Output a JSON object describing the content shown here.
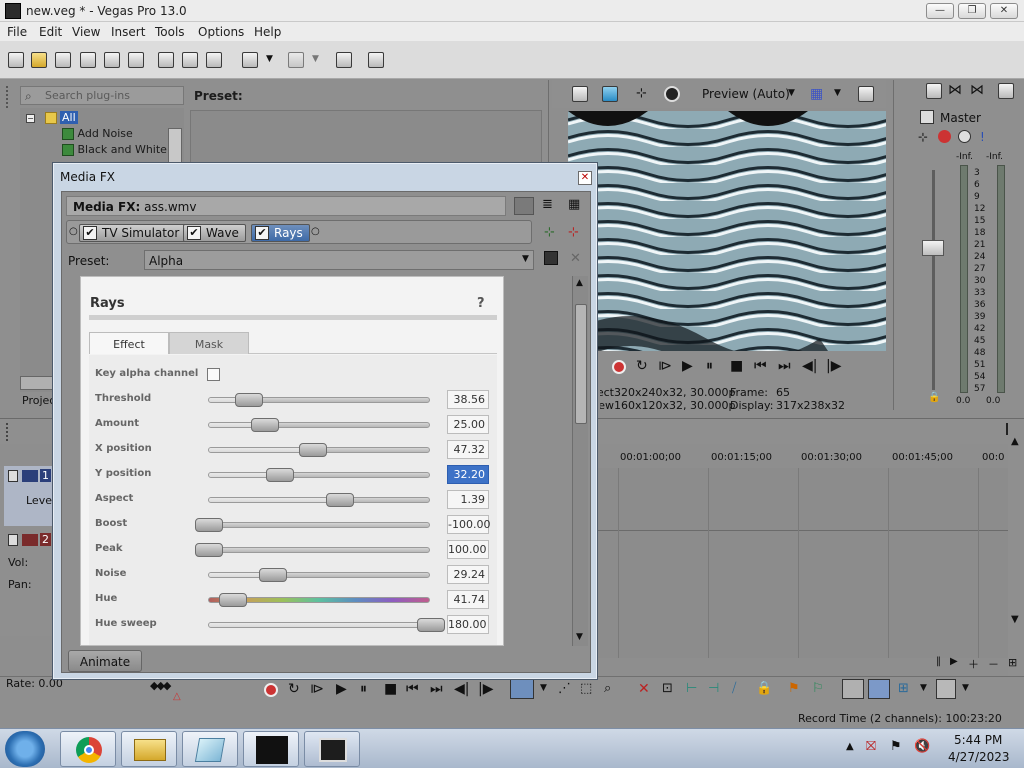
{
  "window": {
    "title": "new.veg * - Vegas Pro 13.0",
    "min_label": "—",
    "max_label": "❐",
    "close_label": "✕"
  },
  "menu": [
    "File",
    "Edit",
    "View",
    "Insert",
    "Tools",
    "Options",
    "Help"
  ],
  "plugins": {
    "search_placeholder": "Search plug-ins",
    "preset_label": "Preset:",
    "tree": [
      "All",
      "Add Noise",
      "Black and White"
    ],
    "project_tab_label": "Projec"
  },
  "preview": {
    "mode_label": "Preview (Auto)",
    "project_label": "Project:",
    "project_value": "320x240x32, 30.000p",
    "frame_label": "Frame:",
    "frame_value": "65",
    "preview_label": "Preview:",
    "preview_value": "160x120x32, 30.000p",
    "display_label": "Display:",
    "display_value": "317x238x32"
  },
  "master": {
    "title": "Master",
    "left_inf": "-Inf.",
    "right_inf": "-Inf.",
    "scale": [
      "3",
      "6",
      "9",
      "12",
      "15",
      "18",
      "21",
      "24",
      "27",
      "30",
      "33",
      "36",
      "39",
      "42",
      "45",
      "48",
      "51",
      "54",
      "57"
    ],
    "left_bottom": "0.0",
    "right_bottom": "0.0"
  },
  "timeline": {
    "ruler": [
      "00:01:00;00",
      "00:01:15;00",
      "00:01:30;00",
      "00:01:45;00",
      "00:0"
    ],
    "track1_number": "1",
    "track1_level_label": "Level",
    "track2_number": "2",
    "track2_vol_label": "Vol:",
    "track2_pan_label": "Pan:",
    "rate_label": "Rate: 0.00",
    "record_time": "Record Time (2 channels): 100:23:20"
  },
  "media_fx": {
    "window_title": "Media FX",
    "header_label": "Media FX:",
    "header_value": "ass.wmv",
    "chain": [
      {
        "label": "TV Simulator",
        "active": false
      },
      {
        "label": "Wave",
        "active": false
      },
      {
        "label": "Rays",
        "active": true
      }
    ],
    "preset_label": "Preset:",
    "preset_value": "Alpha",
    "panel_title": "Rays",
    "help_label": "?",
    "tabs": [
      "Effect",
      "Mask"
    ],
    "key_alpha_label": "Key alpha channel",
    "params": [
      {
        "label": "Threshold",
        "value": "38.56",
        "pos": 0.18
      },
      {
        "label": "Amount",
        "value": "25.00",
        "pos": 0.25
      },
      {
        "label": "X position",
        "value": "47.32",
        "pos": 0.47
      },
      {
        "label": "Y position",
        "value": "32.20",
        "pos": 0.32,
        "selected": true
      },
      {
        "label": "Aspect",
        "value": "1.39",
        "pos": 0.59
      },
      {
        "label": "Boost",
        "value": "-100.00",
        "pos": 0.0
      },
      {
        "label": "Peak",
        "value": "100.00",
        "pos": 0.0
      },
      {
        "label": "Noise",
        "value": "29.24",
        "pos": 0.29
      },
      {
        "label": "Hue",
        "value": "41.74",
        "pos": 0.11
      },
      {
        "label": "Hue sweep",
        "value": "180.00",
        "pos": 1.0
      }
    ],
    "animate_label": "Animate"
  },
  "taskbar": {
    "time": "5:44 PM",
    "date": "4/27/2023"
  }
}
